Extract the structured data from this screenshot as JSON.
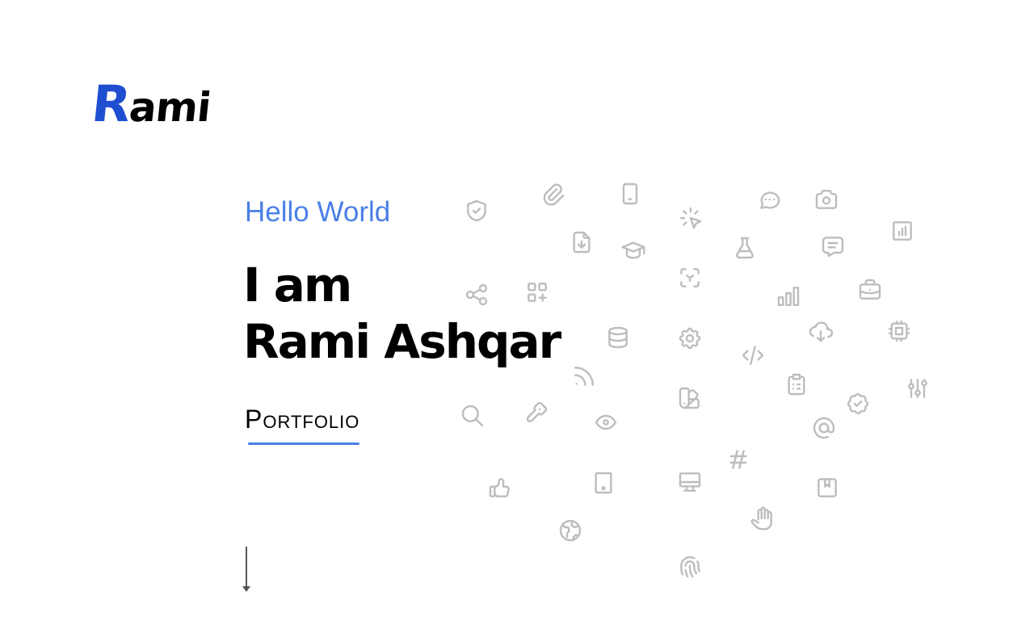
{
  "logo": {
    "first_letter": "R",
    "rest": "ami"
  },
  "hero": {
    "greeting": "Hello World",
    "line1": "I am",
    "line2": "Rami Ashqar",
    "subtitle": "Portfolio"
  },
  "colors": {
    "accent": "#4a7fe6",
    "logo_blue": "#1f4fd1",
    "icon_gray": "#bdbdbd"
  },
  "icons": [
    "shield-check",
    "paperclip",
    "device-mobile",
    "click",
    "message-dots",
    "camera",
    "report-chart",
    "file-download",
    "school",
    "flask",
    "message",
    "scan",
    "share",
    "apps-plus",
    "chart-bar",
    "briefcase",
    "database",
    "settings",
    "code",
    "cloud-download",
    "cpu",
    "rss",
    "clipboard-list",
    "rosette-check",
    "adjustments",
    "palette",
    "search",
    "key",
    "eye",
    "at",
    "hash",
    "thumb-up",
    "device-tablet",
    "device-desktop",
    "bookmark",
    "hand-stop",
    "world",
    "fingerprint"
  ]
}
